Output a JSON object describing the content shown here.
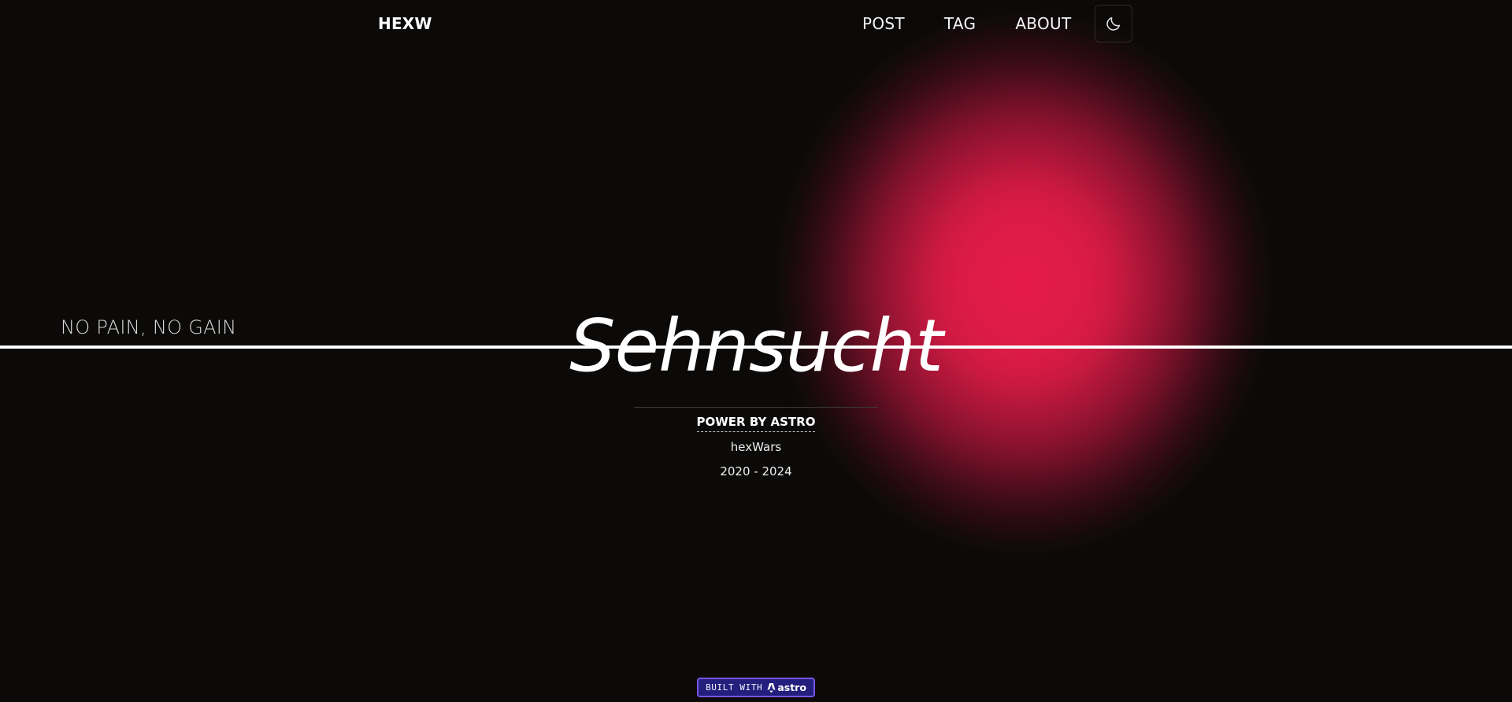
{
  "header": {
    "brand": "HEXW",
    "nav": [
      {
        "label": "POST"
      },
      {
        "label": "TAG"
      },
      {
        "label": "ABOUT"
      }
    ],
    "theme_toggle_icon": "moon-icon"
  },
  "hero": {
    "slogan": "NO PAIN, NO GAIN",
    "title": "Sehnsucht",
    "glow_color": "#e01e4c"
  },
  "footer": {
    "power_label": "POWER BY ASTRO",
    "author": "hexWars",
    "years": "2020 - 2024"
  },
  "badge": {
    "prefix": "BUILT WITH",
    "brand": "astro",
    "icon": "astro-logo-icon",
    "background": "#231f7d",
    "border": "#7a55e6"
  }
}
